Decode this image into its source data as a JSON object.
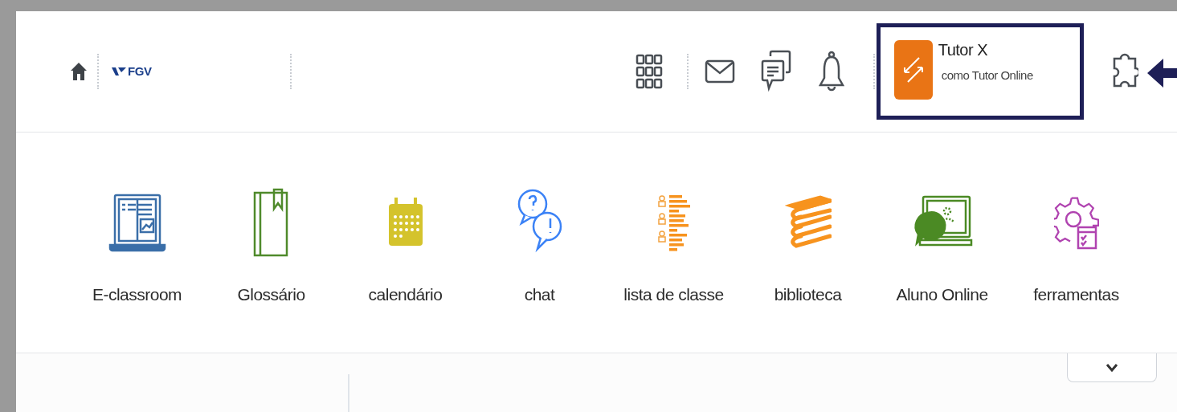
{
  "header": {
    "logo": "FGV",
    "user": {
      "name": "Tutor X",
      "role": "como Tutor Online"
    }
  },
  "tools": [
    {
      "kind": "laptop",
      "label": "E-classroom"
    },
    {
      "kind": "book",
      "label": "Glossário"
    },
    {
      "kind": "calendar",
      "label": "calendário"
    },
    {
      "kind": "chat",
      "label": "chat"
    },
    {
      "kind": "list",
      "label": "lista de classe"
    },
    {
      "kind": "books",
      "label": "biblioteca"
    },
    {
      "kind": "screen",
      "label": "Aluno Online"
    },
    {
      "kind": "gear",
      "label": "ferramentas"
    }
  ]
}
